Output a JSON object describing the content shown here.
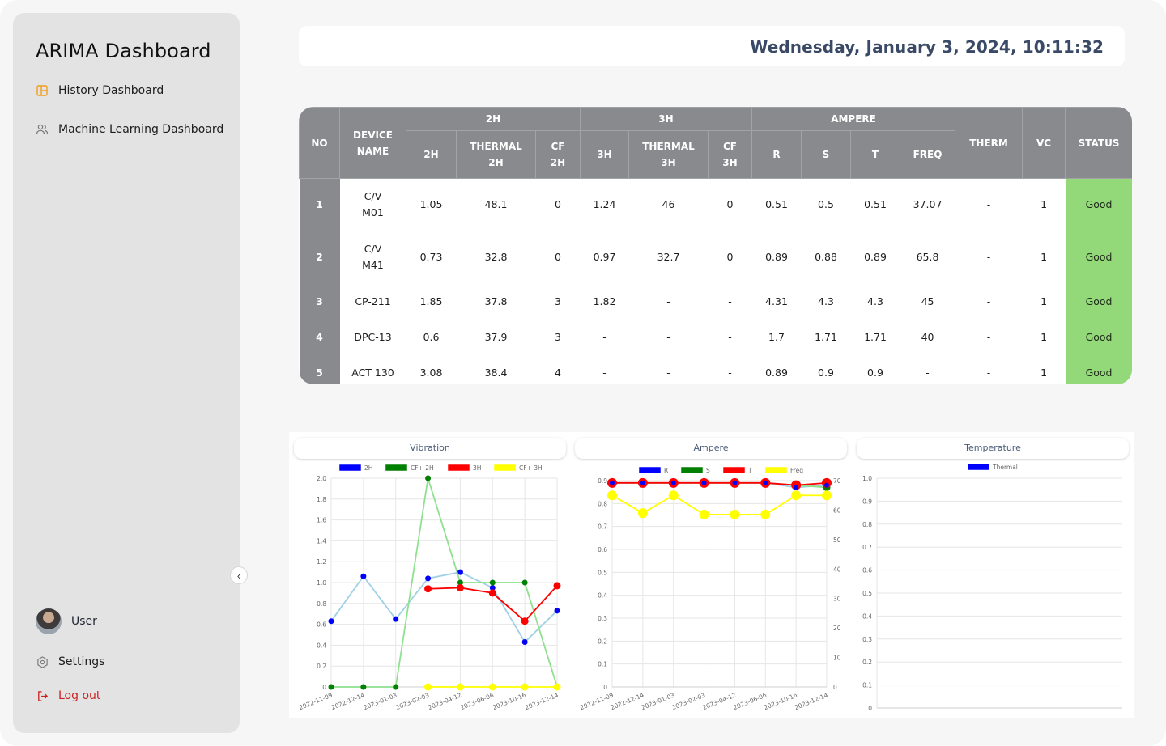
{
  "sidebar": {
    "brand": "ARIMA Dashboard",
    "nav": [
      {
        "label": "History Dashboard",
        "icon": "dashboard-icon",
        "color": "#f29d1f"
      },
      {
        "label": "Machine Learning Dashboard",
        "icon": "users-icon"
      }
    ],
    "user": {
      "name": "User"
    },
    "settings_label": "Settings",
    "logout_label": "Log out",
    "logout_color": "#cc1f1f"
  },
  "header": {
    "datetime": "Wednesday, January 3, 2024, 10:11:32"
  },
  "table": {
    "group_headers": {
      "g2h": "2H",
      "g3h": "3H",
      "gamp": "AMPERE"
    },
    "headers": {
      "no": "NO",
      "device_l1": "DEVICE",
      "device_l2": "NAME",
      "h2h": "2H",
      "thermal2h_l1": "THERMAL",
      "thermal2h_l2": "2H",
      "cf2h_l1": "CF",
      "cf2h_l2": "2H",
      "h3h": "3H",
      "thermal3h_l1": "THERMAL",
      "thermal3h_l2": "3H",
      "cf3h_l1": "CF",
      "cf3h_l2": "3H",
      "r": "R",
      "s": "S",
      "t": "T",
      "freq": "FREQ",
      "therm": "THERM",
      "vc": "VC",
      "status": "STATUS"
    },
    "rows": [
      {
        "no": "1",
        "name_l1": "C/V",
        "name_l2": "M01",
        "v2h": "1.05",
        "th2h": "48.1",
        "cf2h": "0",
        "v3h": "1.24",
        "th3h": "46",
        "cf3h": "0",
        "r": "0.51",
        "s": "0.5",
        "t": "0.51",
        "freq": "37.07",
        "therm": "-",
        "vc": "1",
        "status": "Good"
      },
      {
        "no": "2",
        "name_l1": "C/V",
        "name_l2": "M41",
        "v2h": "0.73",
        "th2h": "32.8",
        "cf2h": "0",
        "v3h": "0.97",
        "th3h": "32.7",
        "cf3h": "0",
        "r": "0.89",
        "s": "0.88",
        "t": "0.89",
        "freq": "65.8",
        "therm": "-",
        "vc": "1",
        "status": "Good"
      },
      {
        "no": "3",
        "name_l1": "CP-211",
        "name_l2": "",
        "v2h": "1.85",
        "th2h": "37.8",
        "cf2h": "3",
        "v3h": "1.82",
        "th3h": "-",
        "cf3h": "-",
        "r": "4.31",
        "s": "4.3",
        "t": "4.3",
        "freq": "45",
        "therm": "-",
        "vc": "1",
        "status": "Good"
      },
      {
        "no": "4",
        "name_l1": "DPC-13",
        "name_l2": "",
        "v2h": "0.6",
        "th2h": "37.9",
        "cf2h": "3",
        "v3h": "-",
        "th3h": "-",
        "cf3h": "-",
        "r": "1.7",
        "s": "1.71",
        "t": "1.71",
        "freq": "40",
        "therm": "-",
        "vc": "1",
        "status": "Good"
      },
      {
        "no": "5",
        "name_l1": "ACT 130",
        "name_l2": "",
        "v2h": "3.08",
        "th2h": "38.4",
        "cf2h": "4",
        "v3h": "-",
        "th3h": "-",
        "cf3h": "-",
        "r": "0.89",
        "s": "0.9",
        "t": "0.9",
        "freq": "-",
        "therm": "-",
        "vc": "1",
        "status": "Good"
      }
    ],
    "status_color": "#93d97a",
    "header_color": "#898a8e"
  },
  "chart_data": [
    {
      "type": "line",
      "title": "Vibration",
      "categories": [
        "2022-11-09",
        "2022-12-14",
        "2023-01-03",
        "2023-02-03",
        "2023-04-12",
        "2023-06-06",
        "2023-10-16",
        "2023-12-14"
      ],
      "ylim": [
        0,
        2.0
      ],
      "yticks": [
        "0",
        "0.2",
        "0.4",
        "0.6",
        "0.8",
        "1.0",
        "1.2",
        "1.4",
        "1.6",
        "1.8",
        "2.0"
      ],
      "series": [
        {
          "name": "2H",
          "color": "#0000ff",
          "line": "#9fd0e6",
          "values": [
            0.63,
            1.06,
            0.65,
            1.04,
            1.1,
            0.95,
            0.43,
            0.73
          ]
        },
        {
          "name": "CF+ 2H",
          "color": "#008000",
          "line": "#8fe08f",
          "values": [
            0,
            0,
            0,
            2.0,
            1.0,
            1.0,
            1.0,
            0
          ]
        },
        {
          "name": "3H",
          "color": "#ff0000",
          "line": "#ff0000",
          "values": [
            null,
            null,
            null,
            0.94,
            0.95,
            0.9,
            0.63,
            0.97
          ]
        },
        {
          "name": "CF+ 3H",
          "color": "#ffff00",
          "line": "#ffff00",
          "values": [
            null,
            null,
            null,
            0,
            0,
            0,
            0,
            0
          ]
        }
      ]
    },
    {
      "type": "line",
      "title": "Ampere",
      "categories": [
        "2022-11-09",
        "2022-12-14",
        "2023-01-03",
        "2023-02-03",
        "2023-04-12",
        "2023-06-06",
        "2023-10-16",
        "2023-12-14"
      ],
      "ylim": [
        0,
        0.9
      ],
      "yticks": [
        "0",
        "0.1",
        "0.2",
        "0.3",
        "0.4",
        "0.5",
        "0.6",
        "0.7",
        "0.8",
        "0.9"
      ],
      "y2lim": [
        0,
        70
      ],
      "y2ticks": [
        "0",
        "10",
        "20",
        "30",
        "40",
        "50",
        "60",
        "70"
      ],
      "series": [
        {
          "name": "R",
          "color": "#0000ff",
          "line": "#9fd0e6",
          "values": [
            0.89,
            0.89,
            0.89,
            0.89,
            0.89,
            0.89,
            0.87,
            0.88
          ]
        },
        {
          "name": "S",
          "color": "#008000",
          "line": "#8fe08f",
          "values": [
            0.89,
            0.89,
            0.89,
            0.89,
            0.89,
            0.89,
            0.88,
            0.87
          ]
        },
        {
          "name": "T",
          "color": "#ff0000",
          "line": "#ff0000",
          "values": [
            0.89,
            0.89,
            0.89,
            0.89,
            0.89,
            0.89,
            0.88,
            0.89
          ]
        },
        {
          "name": "Freq",
          "color": "#ffff00",
          "line": "#ffff00",
          "axis": "right",
          "values": [
            65,
            59,
            65,
            58.5,
            58.5,
            58.5,
            65,
            65
          ]
        }
      ]
    },
    {
      "type": "line",
      "title": "Temperature",
      "categories": [],
      "ylim": [
        0,
        1.0
      ],
      "yticks": [
        "0",
        "0.1",
        "0.2",
        "0.3",
        "0.4",
        "0.5",
        "0.6",
        "0.7",
        "0.8",
        "0.9",
        "1.0"
      ],
      "series": [
        {
          "name": "Thermal",
          "color": "#0000ff",
          "values": []
        }
      ]
    }
  ]
}
